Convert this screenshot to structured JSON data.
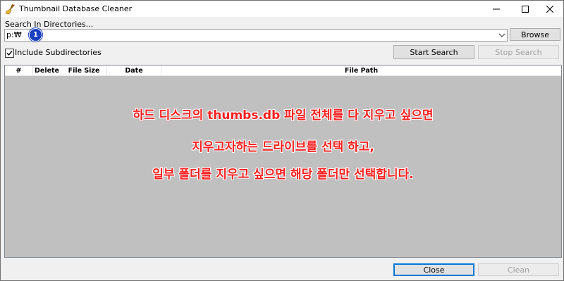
{
  "window": {
    "title": "Thumbnail Database Cleaner",
    "icon": "broom-icon",
    "controls": [
      "minimize-icon",
      "maximize-icon",
      "close-icon"
    ]
  },
  "search": {
    "label": "Search In Directories...",
    "value": "p:₩",
    "browse_label": "Browse"
  },
  "options": {
    "include_subdirectories_label": "Include Subdirectories",
    "include_subdirectories_checked": true
  },
  "actions": {
    "start_label": "Start Search",
    "stop_label": "Stop Search",
    "stop_enabled": false
  },
  "list": {
    "columns": [
      "#",
      "Delete",
      "File Size",
      "Date",
      "File Path"
    ],
    "rows": []
  },
  "annotation": {
    "badge": "1",
    "badge_color": "#1a3fbf",
    "text_color": "#ff1e1e",
    "lines": [
      "하드 디스크의 thumbs.db 파일 전체를 다 지우고 싶으면",
      "지우고자하는 드라이브를 선택 하고,",
      "일부 폴더를 지우고 싶으면 해당 폴더만 선택합니다."
    ]
  },
  "footer": {
    "close_label": "Close",
    "clean_label": "Clean",
    "clean_enabled": false
  }
}
